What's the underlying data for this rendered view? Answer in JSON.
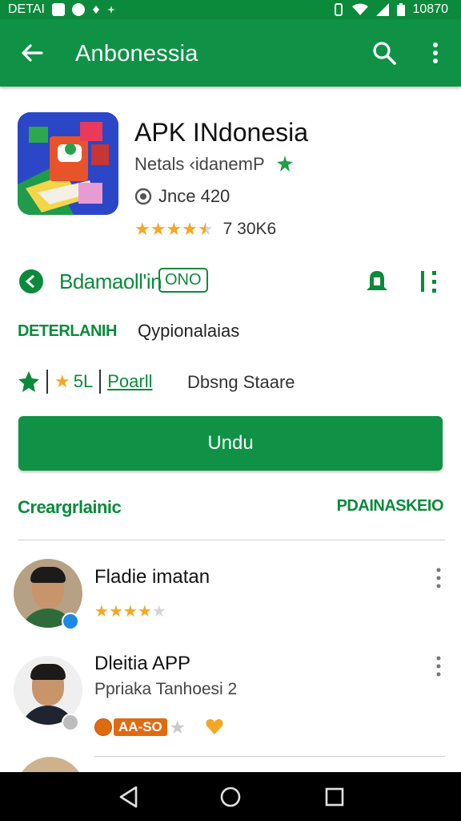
{
  "status_bar": {
    "carrier": "DETAI",
    "battery": "10870"
  },
  "app_bar": {
    "title": "Anbonessia",
    "icons": [
      "arrow-back-icon",
      "search-icon",
      "more-vert-icon"
    ]
  },
  "app": {
    "name": "APK INdonesia",
    "developer": "Netals ‹idanemP",
    "version": "Jnce 420",
    "rating": 4.5,
    "rating_count": "7 30K6"
  },
  "info_row": {
    "label": "Bdamaoll'in",
    "chip": "ONO"
  },
  "details": {
    "key": "DETERLANIH",
    "value": "Qypionalaias"
  },
  "meta_row": {
    "rate": "5L",
    "link": "Poarll",
    "text": "Dbsng Staare"
  },
  "install_button": "Undu",
  "section": {
    "left": "Creargrlainic",
    "right": "PDAINASKEIO"
  },
  "reviews": [
    {
      "name": "Fladie imatan",
      "stars": 4,
      "shirt_color": "#2f6b3a",
      "badge_color": "#1e88e5"
    },
    {
      "name": "Dleitia APP",
      "subtitle": "Ppriaka Tanhoesi 2",
      "tag": "AA-SO",
      "shirt_color": "#ffffff",
      "badge_color": "#bdbdbd"
    }
  ],
  "colors": {
    "primary": "#0f9246",
    "accent_text": "#0b8a3b",
    "star": "#f5a623",
    "nav_bar": "#000000"
  }
}
